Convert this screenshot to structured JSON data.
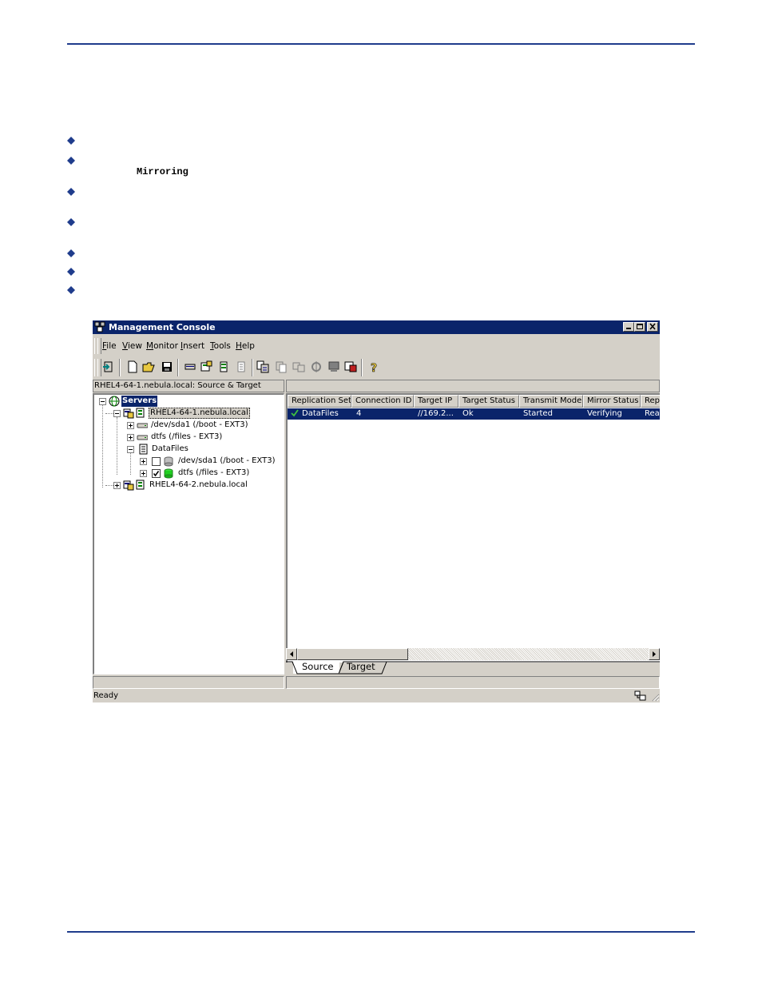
{
  "document": {
    "mono_term": "Mirroring"
  },
  "window": {
    "title": "Management Console",
    "menu": [
      {
        "key": "F",
        "rest": "ile"
      },
      {
        "key": "V",
        "rest": "iew"
      },
      {
        "key": "M",
        "rest": "onitor"
      },
      {
        "key": "I",
        "rest": "nsert"
      },
      {
        "key": "T",
        "rest": "ools"
      },
      {
        "key": "H",
        "rest": "elp"
      }
    ],
    "left_pane_header": "RHEL4-64-1.nebula.local: Source & Target",
    "tree": {
      "root": "Servers",
      "server1": "RHEL4-64-1.nebula.local",
      "item_sda1": "/dev/sda1 (/boot - EXT3)",
      "item_dtfs": "dtfs (/files - EXT3)",
      "item_datafiles": "DataFiles",
      "sub_sda1": "/dev/sda1 (/boot - EXT3)",
      "sub_dtfs": "dtfs (/files - EXT3)",
      "server2": "RHEL4-64-2.nebula.local"
    },
    "columns": [
      "Replication Set",
      "Connection ID",
      "Target IP",
      "Target Status",
      "Transmit Mode",
      "Mirror Status",
      "Rep"
    ],
    "row": {
      "replication_set": "DataFiles",
      "connection_id": "4",
      "target_ip": "//169.2...",
      "target_status": "Ok",
      "transmit_mode": "Started",
      "mirror_status": "Verifying",
      "rep": "Rea"
    },
    "tabs": [
      "Source",
      "Target"
    ],
    "status": "Ready"
  },
  "colors": {
    "rule": "#1f3c8c",
    "bullet": "#1f3c8c",
    "titlebar": "#0a246a",
    "chrome": "#d4d0c8"
  }
}
